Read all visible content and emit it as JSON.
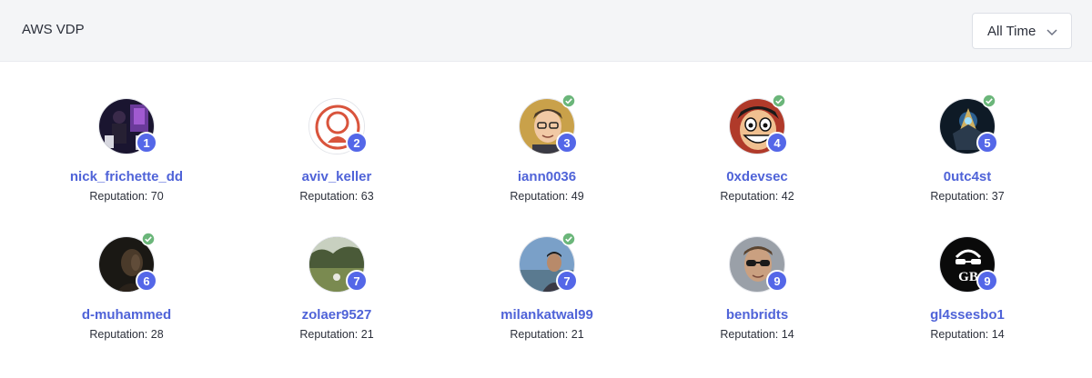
{
  "header": {
    "title": "AWS VDP"
  },
  "filter": {
    "selected": "All Time"
  },
  "users": [
    {
      "rank": "1",
      "username": "nick_frichette_dd",
      "reputation": "Reputation: 70",
      "verified": false,
      "avatar_icon": "stage-photo-avatar"
    },
    {
      "rank": "2",
      "username": "aviv_keller",
      "reputation": "Reputation: 63",
      "verified": false,
      "avatar_icon": "ring-logo-avatar"
    },
    {
      "rank": "3",
      "username": "iann0036",
      "reputation": "Reputation: 49",
      "verified": true,
      "avatar_icon": "cartoon-face-avatar"
    },
    {
      "rank": "4",
      "username": "0xdevsec",
      "reputation": "Reputation: 42",
      "verified": true,
      "avatar_icon": "anime-face-avatar"
    },
    {
      "rank": "5",
      "username": "0utc4st",
      "reputation": "Reputation: 37",
      "verified": true,
      "avatar_icon": "dark-emblem-avatar"
    },
    {
      "rank": "6",
      "username": "d-muhammed",
      "reputation": "Reputation: 28",
      "verified": true,
      "avatar_icon": "dark-portrait-avatar"
    },
    {
      "rank": "7",
      "username": "zolaer9527",
      "reputation": "Reputation: 21",
      "verified": false,
      "avatar_icon": "landscape-avatar"
    },
    {
      "rank": "7",
      "username": "milankatwal99",
      "reputation": "Reputation: 21",
      "verified": true,
      "avatar_icon": "outdoor-portrait-avatar"
    },
    {
      "rank": "9",
      "username": "benbridts",
      "reputation": "Reputation: 14",
      "verified": false,
      "avatar_icon": "sunglasses-portrait-avatar"
    },
    {
      "rank": "9",
      "username": "gl4ssesbo1",
      "reputation": "Reputation: 14",
      "verified": false,
      "avatar_icon": "gb-logo-avatar"
    }
  ],
  "colors": {
    "accent": "#5467e8",
    "link": "#4f63d8",
    "verified": "#6bb67a",
    "header_bg": "#f4f5f7"
  }
}
